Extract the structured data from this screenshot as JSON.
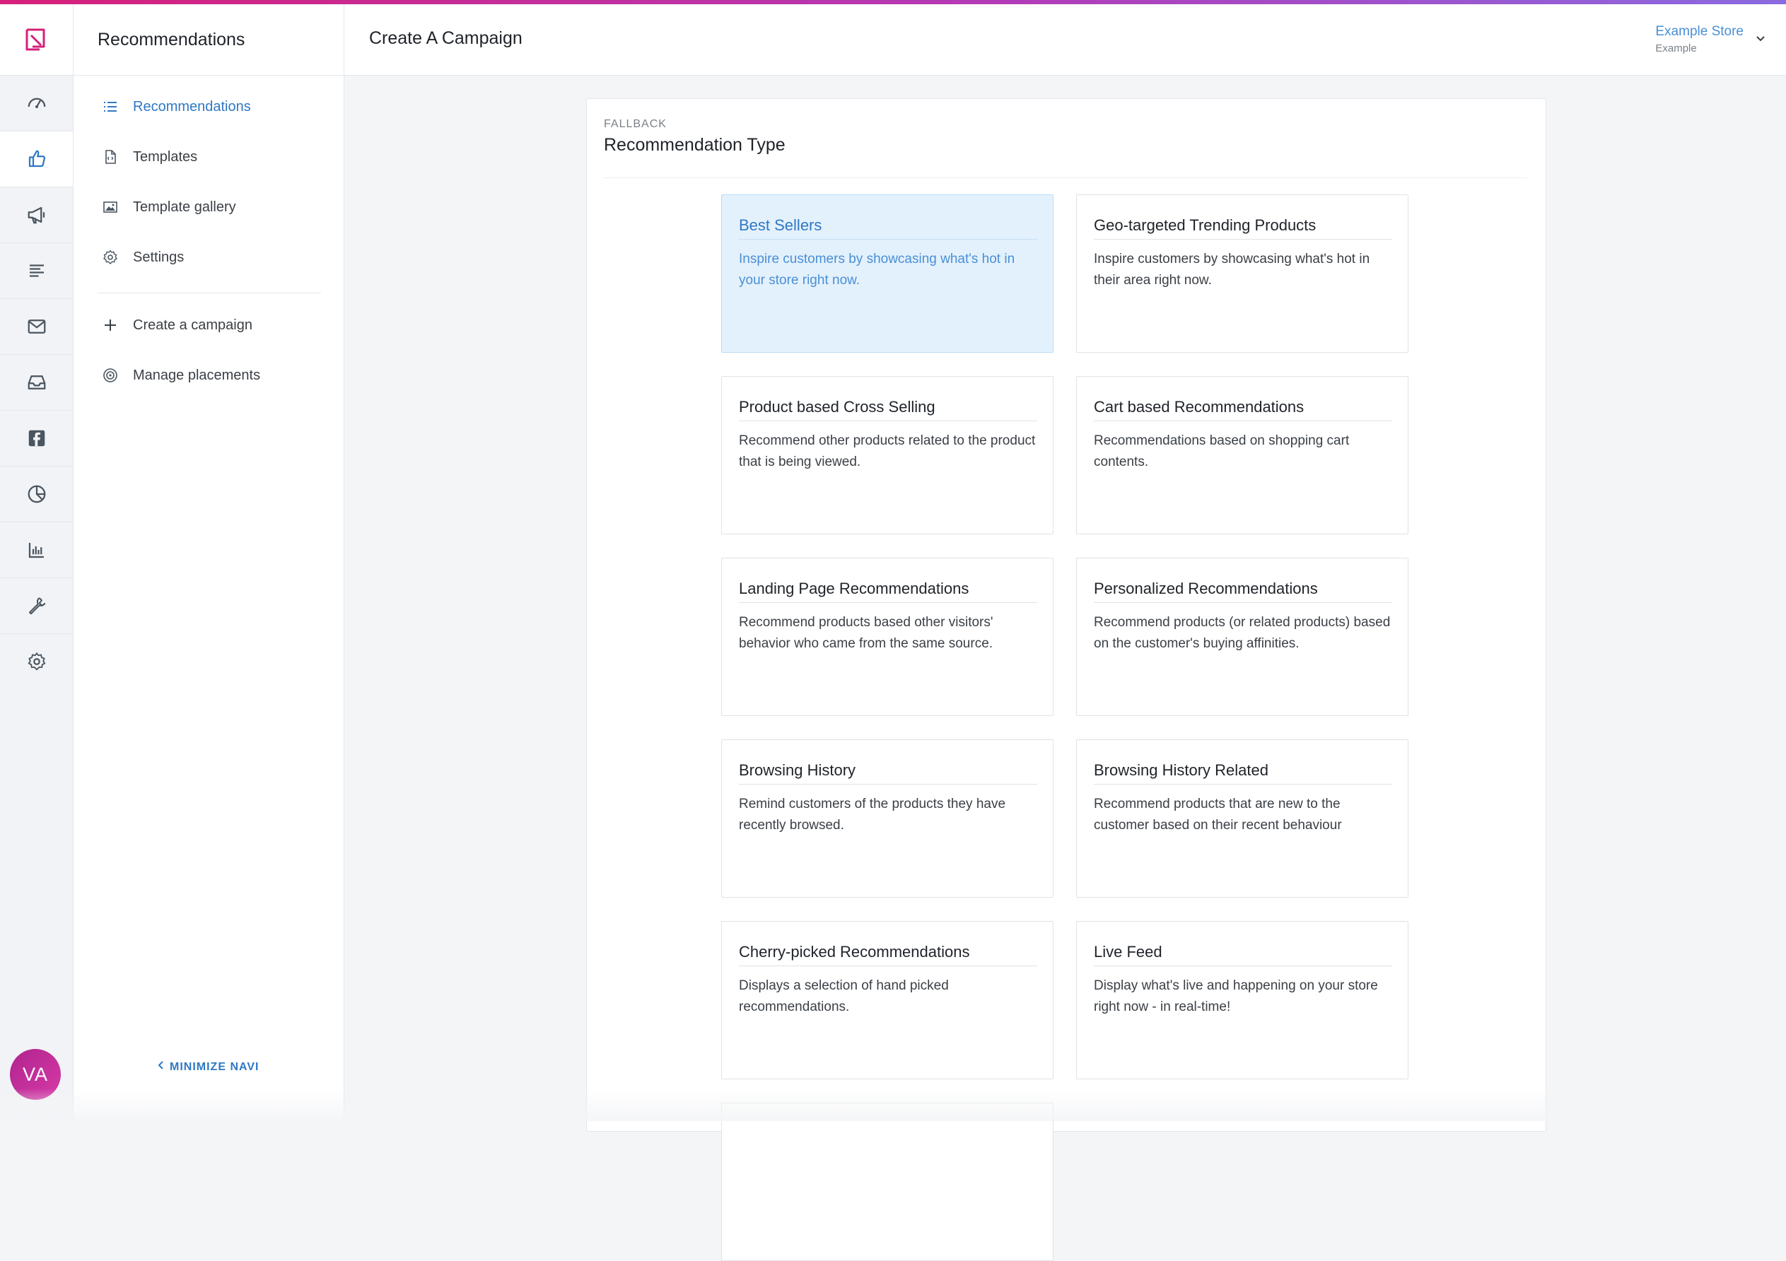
{
  "rail": {
    "items": [
      {
        "icon": "dashboard-icon"
      },
      {
        "icon": "thumbs-up-icon",
        "active": true
      },
      {
        "icon": "megaphone-icon"
      },
      {
        "icon": "list-icon"
      },
      {
        "icon": "envelope-icon"
      },
      {
        "icon": "inbox-icon"
      },
      {
        "icon": "facebook-icon"
      },
      {
        "icon": "pie-chart-icon"
      },
      {
        "icon": "bar-chart-icon"
      },
      {
        "icon": "wrench-icon"
      },
      {
        "icon": "gear-icon"
      }
    ],
    "avatar_initials": "VA"
  },
  "subnav": {
    "title": "Recommendations",
    "items": [
      {
        "label": "Recommendations",
        "icon": "list-icon",
        "active": true
      },
      {
        "label": "Templates",
        "icon": "file-code-icon"
      },
      {
        "label": "Template gallery",
        "icon": "image-icon"
      },
      {
        "label": "Settings",
        "icon": "gear-icon"
      },
      {
        "label": "Create a campaign",
        "icon": "plus-icon"
      },
      {
        "label": "Manage placements",
        "icon": "target-icon"
      }
    ],
    "minimize_label": "MINIMIZE NAVI"
  },
  "header": {
    "title": "Create A Campaign",
    "store_name": "Example Store",
    "store_sub": "Example"
  },
  "panel": {
    "eyebrow": "FALLBACK",
    "title": "Recommendation Type",
    "cards": [
      {
        "title": "Best Sellers",
        "desc": "Inspire customers by showcasing what's hot in your store right now.",
        "selected": true
      },
      {
        "title": "Geo-targeted Trending Products",
        "desc": "Inspire customers by showcasing what's hot in their area right now."
      },
      {
        "title": "Product based Cross Selling",
        "desc": "Recommend other products related to the product that is being viewed."
      },
      {
        "title": "Cart based Recommendations",
        "desc": "Recommendations based on shopping cart contents."
      },
      {
        "title": "Landing Page Recommendations",
        "desc": "Recommend products based other visitors' behavior who came from the same source."
      },
      {
        "title": "Personalized Recommendations",
        "desc": "Recommend products (or related products) based on the customer's buying affinities."
      },
      {
        "title": "Browsing History",
        "desc": "Remind customers of the products they have recently browsed."
      },
      {
        "title": "Browsing History Related",
        "desc": "Recommend products that are new to the customer based on their recent behaviour"
      },
      {
        "title": "Cherry-picked Recommendations",
        "desc": "Displays a selection of hand picked recommendations."
      },
      {
        "title": "Live Feed",
        "desc": "Display what's live and happening on your store right now - in real-time!"
      },
      {
        "title": "",
        "desc": ""
      }
    ]
  },
  "colors": {
    "accent": "#2f78c4",
    "brand": "#d6207a",
    "selected_bg": "#e3f1fc"
  }
}
